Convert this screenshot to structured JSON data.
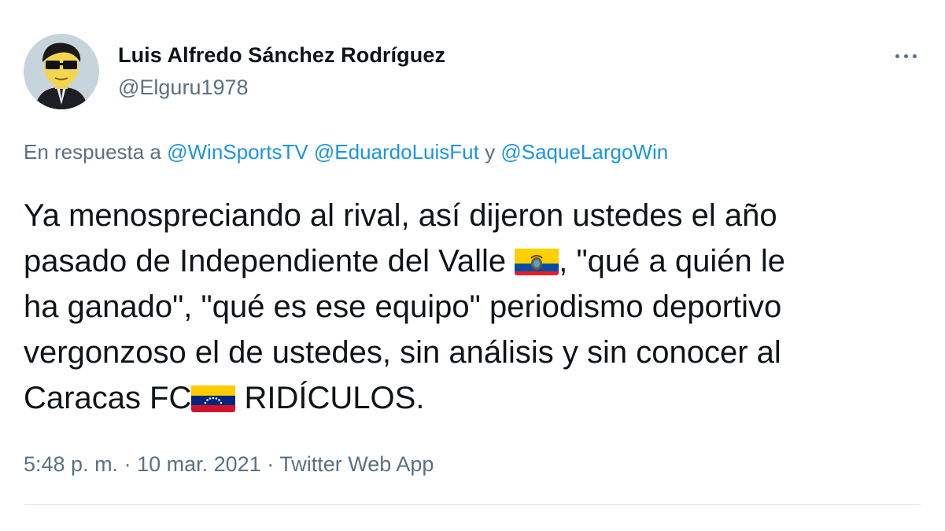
{
  "author": {
    "name": "Luis Alfredo Sánchez Rodríguez",
    "handle": "@Elguru1978"
  },
  "reply_to": {
    "prefix": "En respuesta a",
    "mentions": [
      "@WinSportsTV",
      "@EduardoLuisFut"
    ],
    "conjunction": "y",
    "last_mention": "@SaqueLargoWin"
  },
  "tweet": {
    "line1": "Ya menospreciando al rival, así dijeron ustedes el año",
    "line2_a": "pasado de Independiente del Valle",
    "line2_b": ", \"qué a quién le",
    "line3": "ha ganado\", \"qué es ese equipo\" periodismo deportivo",
    "line4": "vergonzoso el de ustedes, sin análisis y sin conocer al",
    "line5_a": "Caracas FC",
    "line5_b": " RIDÍCULOS."
  },
  "flags": {
    "ecuador": "ecuador-flag-icon",
    "venezuela": "venezuela-flag-icon"
  },
  "meta": {
    "time": "5:48 p. m.",
    "sep1": "·",
    "date": "10 mar. 2021",
    "sep2": "·",
    "source": "Twitter Web App"
  },
  "colors": {
    "text": "#0f1419",
    "secondary": "#5b7083",
    "link": "#1b95e0",
    "divider": "#e1e8ed"
  }
}
